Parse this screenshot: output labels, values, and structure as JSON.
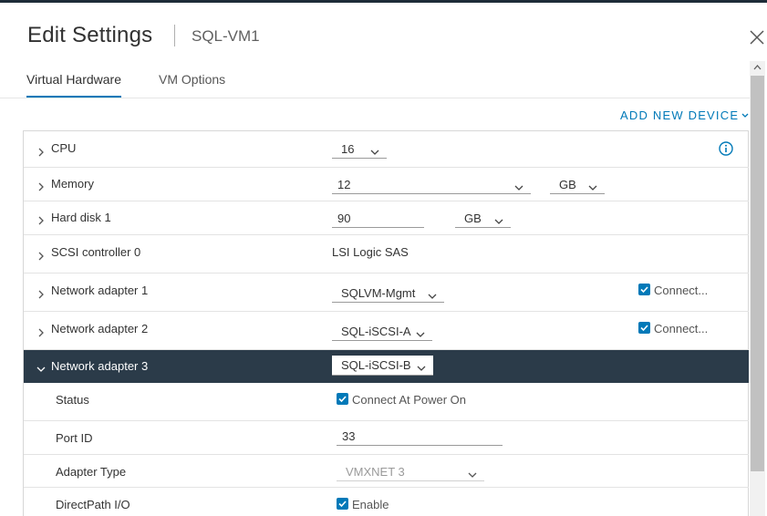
{
  "dialog": {
    "title": "Edit Settings",
    "subtitle": "SQL-VM1"
  },
  "tabs": [
    {
      "label": "Virtual Hardware",
      "active": true
    },
    {
      "label": "VM Options",
      "active": false
    }
  ],
  "add_device_label": "ADD NEW DEVICE",
  "hardware": {
    "cpu": {
      "label": "CPU",
      "value": "16"
    },
    "memory": {
      "label": "Memory",
      "value": "12",
      "unit": "GB"
    },
    "hard_disk": {
      "label": "Hard disk 1",
      "value": "90",
      "unit": "GB"
    },
    "scsi": {
      "label": "SCSI controller 0",
      "value": "LSI Logic SAS"
    },
    "net1": {
      "label": "Network adapter 1",
      "network": "SQLVM-Mgmt",
      "connect_label": "Connect..."
    },
    "net2": {
      "label": "Network adapter 2",
      "network": "SQL-iSCSI-A",
      "connect_label": "Connect..."
    },
    "net3": {
      "label": "Network adapter 3",
      "network": "SQL-iSCSI-B"
    }
  },
  "net3_details": {
    "status": {
      "label": "Status",
      "checkbox_label": "Connect At Power On"
    },
    "port_id": {
      "label": "Port ID",
      "value": "33"
    },
    "adapter_type": {
      "label": "Adapter Type",
      "value": "VMXNET 3"
    },
    "directpath": {
      "label": "DirectPath I/O",
      "checkbox_label": "Enable"
    }
  },
  "colors": {
    "accent": "#0079b8",
    "selected_row": "#2b3b49",
    "background": "#1e2c38"
  },
  "icons": [
    "close-icon",
    "chevron-right-icon",
    "chevron-down-icon",
    "info-icon",
    "checkbox-checked-icon",
    "scroll-up-arrow-icon"
  ]
}
